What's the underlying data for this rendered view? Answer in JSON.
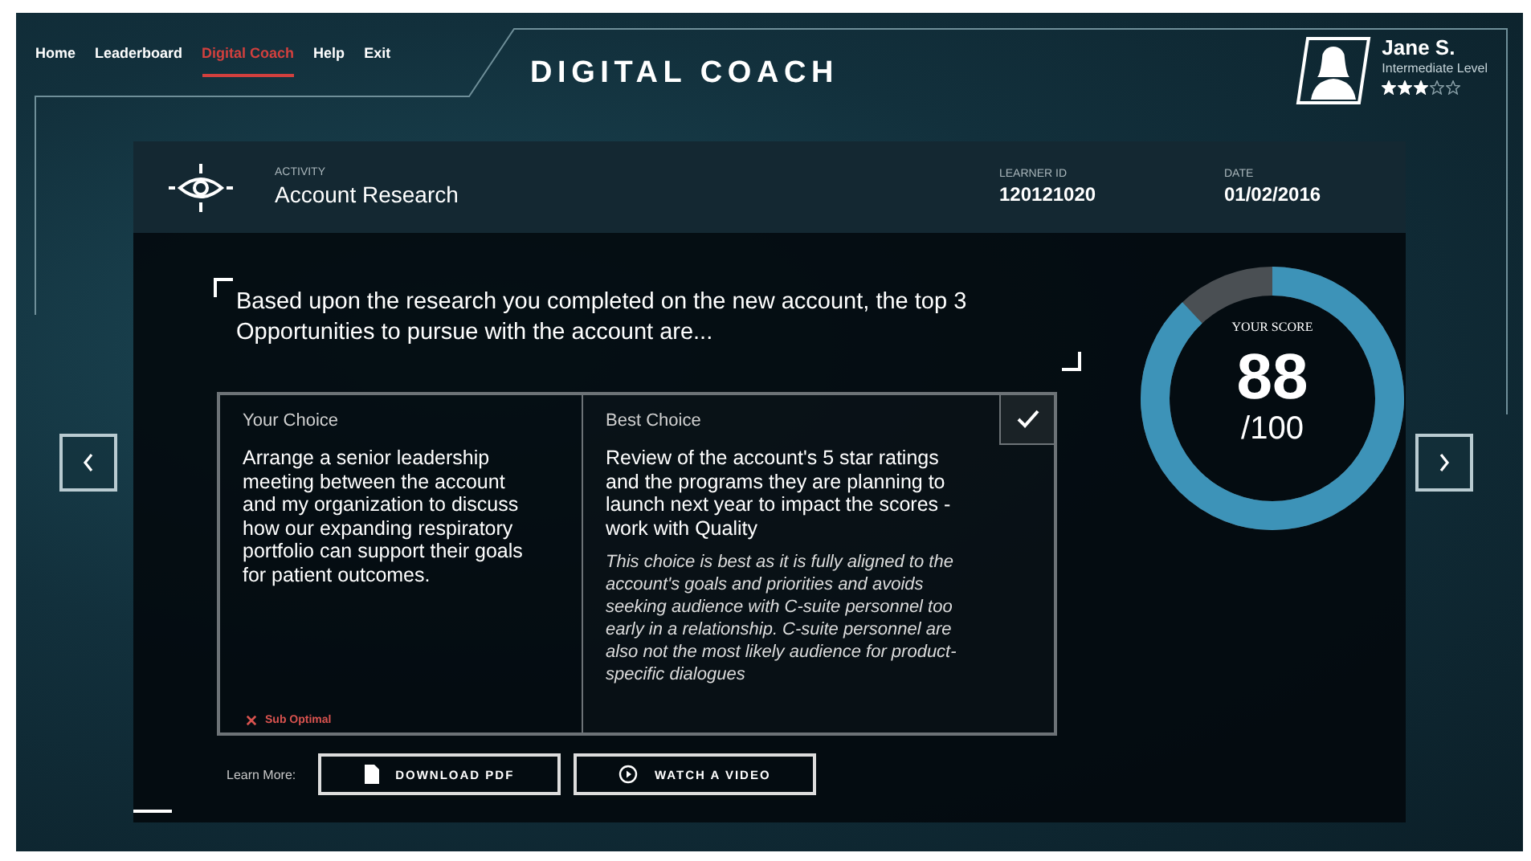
{
  "nav": [
    {
      "label": "Home",
      "selected": false
    },
    {
      "label": "Leaderboard",
      "selected": false
    },
    {
      "label": "Digital Coach",
      "selected": true
    },
    {
      "label": "Help",
      "selected": false
    },
    {
      "label": "Exit",
      "selected": false
    }
  ],
  "app_title": "DIGITAL COACH",
  "user": {
    "name": "Jane S.",
    "level_label": "Intermediate Level",
    "stars": 3
  },
  "activity": {
    "label": "ACTIVITY",
    "value": "Account Research"
  },
  "learner_id": {
    "label": "LEARNER ID",
    "value": "120121020"
  },
  "date": {
    "label": "DATE",
    "value": "01/02/2016"
  },
  "question": "Based upon the research you completed on the new account, the top 3 Opportunities to pursue with the account are...",
  "choices": [
    {
      "kind": "yours",
      "heading": "Your Choice",
      "text": "Arrange a senior leadership meeting between the account and my organization to discuss how our expanding respiratory portfolio can support their goals for patient outcomes.",
      "result": "Sub Optimal",
      "checked": false
    },
    {
      "kind": "best",
      "heading": "Best Choice",
      "text": "Review of the account's 5 star ratings and the programs they are planning to launch next year to impact the scores - work with Quality",
      "explanation": "This choice is best as it is fully aligned to the account's goals and priorities and avoids seeking audience with C-suite personnel too early in a relationship. C-suite personnel are also not the most likely audience for product-specific dialogues",
      "checked": true
    }
  ],
  "score": {
    "label": "YOUR SCORE",
    "value": "88",
    "total": "/100",
    "level": 0.88
  },
  "learn_more": {
    "label": "Learn More:",
    "buttons": [
      {
        "kind": "pdf",
        "label": "DOWNLOAD PDF"
      },
      {
        "kind": "video",
        "label": "WATCH A VIDEO"
      }
    ]
  }
}
